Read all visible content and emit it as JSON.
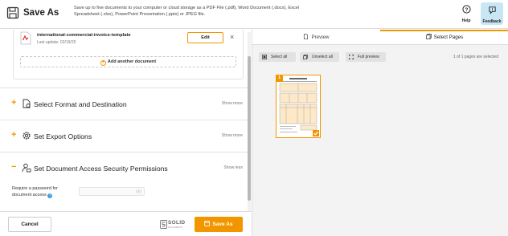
{
  "header": {
    "title": "Save As",
    "description": "Save up to five documents to your computer or cloud storage as a PDF File (.pdf), Word Document (.docx), Excel Spreadsheet (.xlsx), PowerPoint Presentation (.pptx) or JPEG file.",
    "help_label": "Help",
    "feedback_label": "Feedback"
  },
  "document": {
    "name": "international-commercial-invoice-template",
    "last_update": "Last update: 02/19/25",
    "edit_label": "Edit",
    "close_glyph": "×",
    "add_another_label": "Add another document"
  },
  "sections": [
    {
      "sign": "+",
      "title": "Select Format and Destination",
      "toggle": "Show more",
      "icon": "file-gear-icon"
    },
    {
      "sign": "+",
      "title": "Set Export Options",
      "toggle": "Show more",
      "icon": "gear-icon"
    },
    {
      "sign": "−",
      "title": "Set Document Access Security Permissions",
      "toggle": "Show less",
      "icon": "user-lock-icon"
    }
  ],
  "password": {
    "label_line1": "Require a password for",
    "label_line2": "document access",
    "info_glyph": "?",
    "value": "",
    "placeholder": ""
  },
  "footer": {
    "cancel_label": "Cancel",
    "logo_name": "SOLID",
    "logo_sub": "DOCUMENTS",
    "save_as_label": "Save As"
  },
  "right_panel": {
    "tab_preview": "Preview",
    "tab_select_pages": "Select Pages",
    "select_all": "Select all",
    "unselect_all": "Unselect all",
    "full_preview": "Full preview",
    "pages_count": "1 of 1 pages are selected",
    "page_number": "1"
  },
  "colors": {
    "accent": "#f29600",
    "feedback_bg": "#c9e6f5",
    "info": "#3b9bd8"
  }
}
